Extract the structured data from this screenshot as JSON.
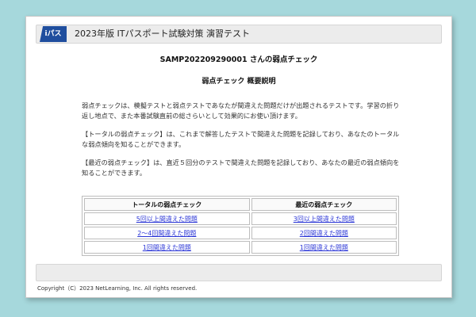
{
  "header": {
    "logo_text": "iパス",
    "title": "2023年版 ITパスポート試験対策 演習テスト"
  },
  "main": {
    "user_title": "SAMP202209290001 さんの弱点チェック",
    "section_title": "弱点チェック 概要説明",
    "paragraphs": [
      "弱点チェックは、模擬テストと弱点テストであなたが間違えた問題だけが出題されるテストです。学習の折り返し地点で、また本番試験直前の総さらいとして効果的にお使い頂けます。",
      "【トータルの弱点チェック】は、これまで解答したテストで間違えた問題を記録しており、あなたのトータルな弱点傾向を知ることができます。",
      "【最近の弱点チェック】は、直近５回分のテストで間違えた問題を記録しており、あなたの最近の弱点傾向を知ることができます。"
    ],
    "table": {
      "headers": [
        "トータルの弱点チェック",
        "最近の弱点チェック"
      ],
      "rows": [
        [
          "5回以上間違えた問題",
          "3回以上間違えた問題"
        ],
        [
          "2〜4回間違えた問題",
          "2回間違えた問題"
        ],
        [
          "1回間違えた問題",
          "1回間違えた問題"
        ]
      ]
    }
  },
  "footer": {
    "copyright": "Copyright（C）2023 NetLearning, Inc. All rights reserved."
  }
}
